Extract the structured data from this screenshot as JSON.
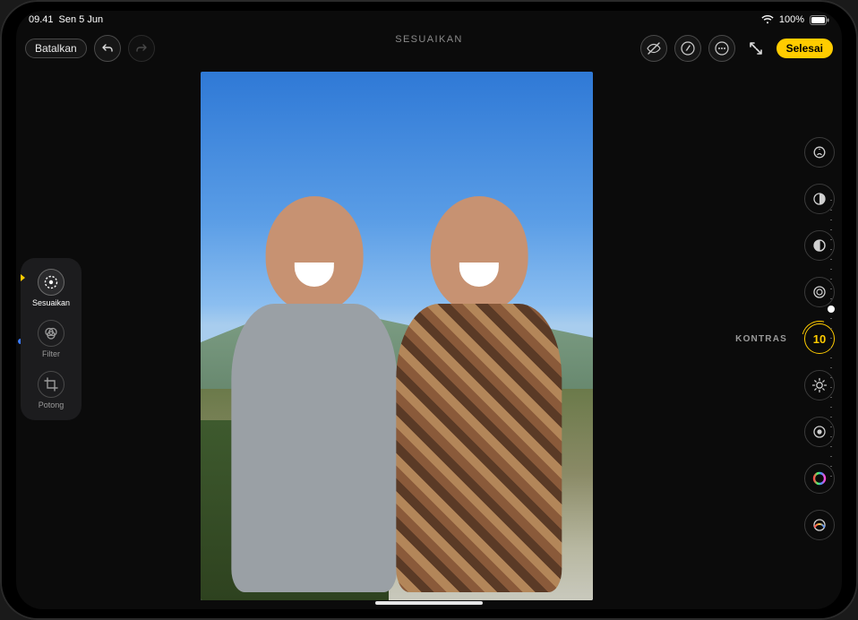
{
  "status": {
    "time": "09.41",
    "date": "Sen 5 Jun",
    "battery_percent": "100%"
  },
  "toolbar": {
    "cancel_label": "Batalkan",
    "done_label": "Selesai",
    "mode_heading": "SESUAIKAN"
  },
  "left_modes": {
    "adjust": "Sesuaikan",
    "filter": "Filter",
    "crop": "Potong"
  },
  "adjust": {
    "active_label": "KONTRAS",
    "active_value": "10"
  },
  "colors": {
    "accent": "#ffcc00",
    "bg": "#0b0b0b",
    "panel": "#1c1c1e"
  }
}
